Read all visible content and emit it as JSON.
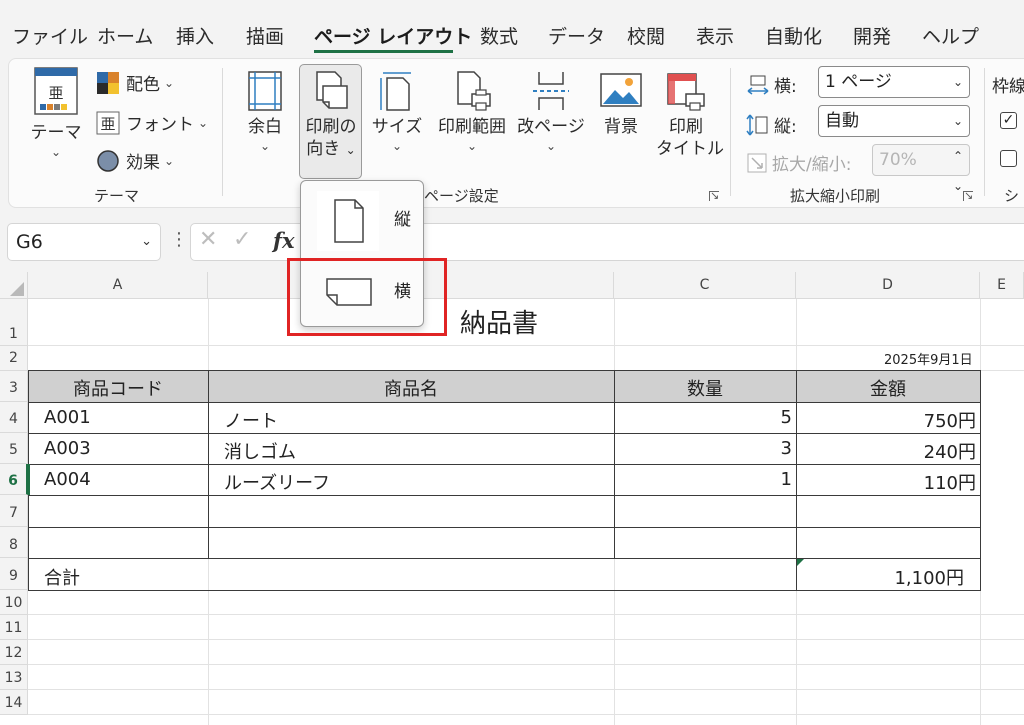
{
  "tabs": [
    "ファイル",
    "ホーム",
    "挿入",
    "描画",
    "ページ レイアウト",
    "数式",
    "データ",
    "校閲",
    "表示",
    "自動化",
    "開発",
    "ヘルプ"
  ],
  "active_tab": "ページ レイアウト",
  "ribbon": {
    "theme_group": {
      "theme_label": "テーマ",
      "colors_label": "配色",
      "fonts_label": "フォント",
      "effects_label": "効果",
      "group_label": "テーマ"
    },
    "page_setup": {
      "margins_label": "余白",
      "orientation_label_1": "印刷の",
      "orientation_label_2": "向き",
      "size_label": "サイズ",
      "print_area_label": "印刷範囲",
      "breaks_label": "改ページ",
      "background_label": "背景",
      "print_titles_label_1": "印刷",
      "print_titles_label_2": "タイトル",
      "group_label": "ページ設定"
    },
    "scale_to_fit": {
      "width_label": "横:",
      "width_value": "1 ページ",
      "height_label": "縦:",
      "height_value": "自動",
      "scale_label": "拡大/縮小:",
      "scale_value": "70%",
      "group_label": "拡大縮小印刷"
    },
    "sheet_options": {
      "gridlines_label": "枠線",
      "group_label": "シ"
    }
  },
  "orientation_dropdown": {
    "items": [
      {
        "label": "縦"
      },
      {
        "label": "横"
      }
    ],
    "highlight_color": "#e02424"
  },
  "formula_bar": {
    "name_box": "G6",
    "fx": "fx"
  },
  "columns": [
    "A",
    "B",
    "C",
    "D",
    "E"
  ],
  "rows": [
    "1",
    "2",
    "3",
    "4",
    "5",
    "6",
    "7",
    "8",
    "9",
    "10",
    "11",
    "12",
    "13",
    "14"
  ],
  "selected_row": "6",
  "sheet": {
    "title": "納品書",
    "date": "2025年9月1日",
    "headers": [
      "商品コード",
      "商品名",
      "数量",
      "金額"
    ],
    "items": [
      {
        "code": "A001",
        "name": "ノート",
        "qty": "5",
        "amount": "750円"
      },
      {
        "code": "A003",
        "name": "消しゴム",
        "qty": "3",
        "amount": "240円"
      },
      {
        "code": "A004",
        "name": "ルーズリーフ",
        "qty": "1",
        "amount": "110円"
      }
    ],
    "total_label": "合計",
    "total_amount": "1,100円"
  },
  "colors": {
    "accent": "#1e7145",
    "header_fill": "#d0d0d0",
    "highlight": "#e02424"
  }
}
